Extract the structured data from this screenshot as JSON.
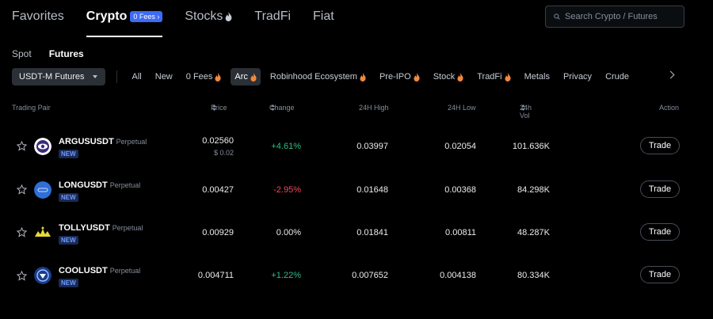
{
  "top_tabs": [
    {
      "label": "Favorites"
    },
    {
      "label": "Crypto",
      "badge": "0 Fees"
    },
    {
      "label": "Stocks"
    },
    {
      "label": "TradFi"
    },
    {
      "label": "Fiat"
    }
  ],
  "search": {
    "placeholder": "Search Crypto / Futures"
  },
  "sub_tabs": [
    {
      "label": "Spot"
    },
    {
      "label": "Futures"
    }
  ],
  "market_select": {
    "label": "USDT-M Futures"
  },
  "filters": [
    {
      "label": "All"
    },
    {
      "label": "New"
    },
    {
      "label": "0 Fees"
    },
    {
      "label": "Arc"
    },
    {
      "label": "Robinhood Ecosystem"
    },
    {
      "label": "Pre-IPO"
    },
    {
      "label": "Stock"
    },
    {
      "label": "TradFi"
    },
    {
      "label": "Metals"
    },
    {
      "label": "Privacy"
    },
    {
      "label": "Crude"
    }
  ],
  "table": {
    "headers": {
      "pair": "Trading Pair",
      "price": "Price",
      "change": "Change",
      "high": "24H High",
      "low": "24H Low",
      "vol": "24h Vol",
      "action": "Action"
    },
    "rows": [
      {
        "symbol": "ARGUSUSDT",
        "type": "Perpetual",
        "badge": "NEW",
        "price": "0.02560",
        "usd": "$ 0.02",
        "change": "+4.61%",
        "high": "0.03997",
        "low": "0.02054",
        "vol": "101.636K",
        "action": "Trade"
      },
      {
        "symbol": "LONGUSDT",
        "type": "Perpetual",
        "badge": "NEW",
        "price": "0.00427",
        "usd": "",
        "change": "-2.95%",
        "high": "0.01648",
        "low": "0.00368",
        "vol": "84.298K",
        "action": "Trade"
      },
      {
        "symbol": "TOLLYUSDT",
        "type": "Perpetual",
        "badge": "NEW",
        "price": "0.00929",
        "usd": "",
        "change": "0.00%",
        "high": "0.01841",
        "low": "0.00811",
        "vol": "48.287K",
        "action": "Trade"
      },
      {
        "symbol": "COOLUSDT",
        "type": "Perpetual",
        "badge": "NEW",
        "price": "0.004711",
        "usd": "",
        "change": "+1.22%",
        "high": "0.007652",
        "low": "0.004138",
        "vol": "80.334K",
        "action": "Trade"
      }
    ]
  },
  "colors": {
    "up": "#2ebd85",
    "down": "#f6465d",
    "accent": "#3d6bf5",
    "flame": "#f0883e"
  },
  "icons": {
    "search": "search-icon",
    "star": "star-icon",
    "flame": "flame-icon",
    "chevron": "chevron-right-icon"
  }
}
